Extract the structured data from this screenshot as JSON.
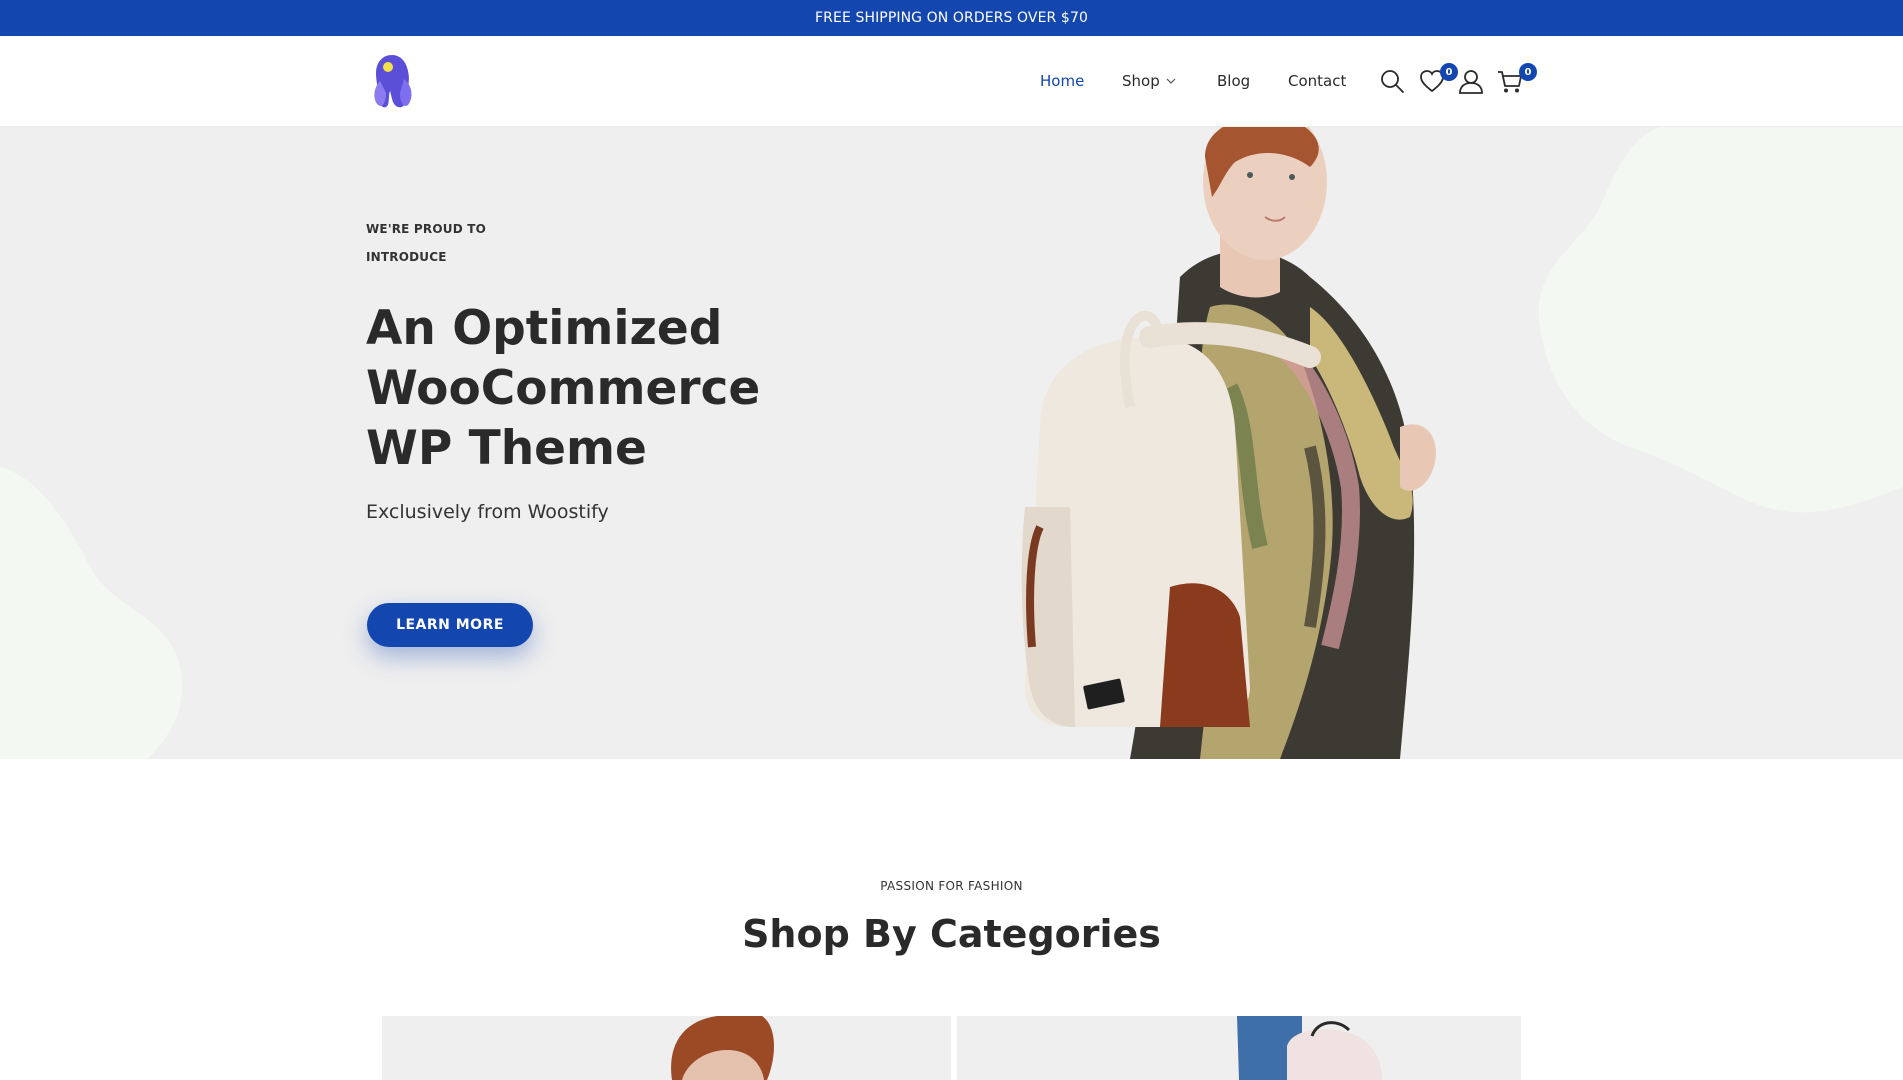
{
  "topbar": {
    "text": "FREE SHIPPING ON ORDERS OVER $70"
  },
  "nav": {
    "home": "Home",
    "shop": "Shop",
    "blog": "Blog",
    "contact": "Contact"
  },
  "header_icons": {
    "wishlist_count": "0",
    "cart_count": "0"
  },
  "hero": {
    "kicker_line1": "WE'RE PROUD TO",
    "kicker_line2": "INTRODUCE",
    "title_line1": "An Optimized",
    "title_line2": "WooCommerce",
    "title_line3": "WP Theme",
    "subtitle": "Exclusively from Woostify",
    "button": "LEARN MORE"
  },
  "categories": {
    "kicker": "PASSION FOR FASHION",
    "title": "Shop By Categories"
  },
  "colors": {
    "brand": "#1346af",
    "hero_bg": "#efefef",
    "blob": "#f4f8f2"
  }
}
